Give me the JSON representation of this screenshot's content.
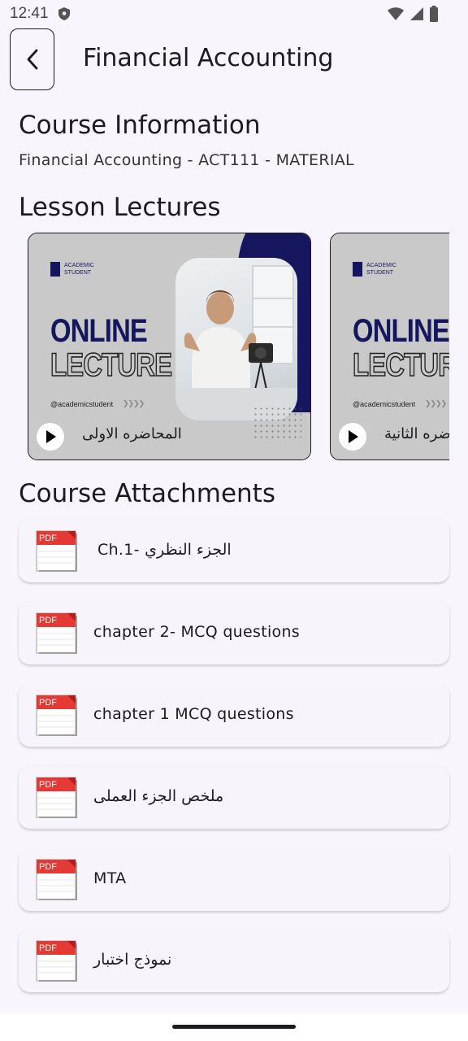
{
  "status_bar": {
    "time": "12:41"
  },
  "header": {
    "title": "Financial Accounting"
  },
  "course_information": {
    "heading": "Course Information",
    "description": "Financial Accounting - ACT111 - MATERIAL"
  },
  "lesson_lectures": {
    "heading": "Lesson Lectures",
    "items": [
      {
        "label": "المحاضره الاولى",
        "thumb_brand": "ACADEMIC STUDENT",
        "thumb_line1": "ONLINE",
        "thumb_line2": "LECTURE",
        "thumb_handle": "@academicstudent"
      },
      {
        "label": "المحاضره الثانية",
        "thumb_brand": "ACADEMIC STUDENT",
        "thumb_line1": "ONLINE",
        "thumb_line2": "LECTURE",
        "thumb_handle": "@academicstudent"
      }
    ]
  },
  "course_attachments": {
    "heading": "Course Attachments",
    "icon_text": "PDF",
    "items": [
      {
        "label": "Ch.1- الجزء النظري"
      },
      {
        "label": "chapter 2- MCQ questions"
      },
      {
        "label": "chapter 1 MCQ questions"
      },
      {
        "label": "ملخص الجزء العملى"
      },
      {
        "label": "MTA"
      },
      {
        "label": "نموذج اختبار"
      }
    ]
  },
  "colors": {
    "accent_navy": "#15165e",
    "pdf_red": "#e53935",
    "background": "#f8f6fc"
  }
}
